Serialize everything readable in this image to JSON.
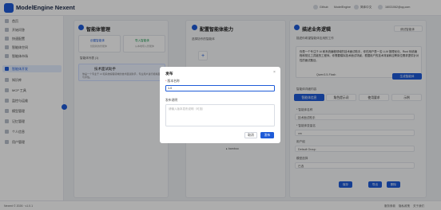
{
  "header": {
    "app_name": "ModelEngine Nexent",
    "links": [
      "Github",
      "ModelEngine",
      "简体中文"
    ],
    "user": "16031062@qq.com"
  },
  "sidebar": {
    "items": [
      {
        "label": "首页",
        "icon": "home-icon"
      },
      {
        "label": "开始问答",
        "icon": "chat-icon"
      },
      {
        "label": "快速配置",
        "icon": "zap-icon"
      },
      {
        "label": "智能体空间",
        "icon": "grid-icon"
      },
      {
        "label": "智能体市场",
        "icon": "store-icon"
      },
      {
        "label": "智能体开发",
        "icon": "code-icon",
        "active": true
      },
      {
        "label": "知识库",
        "icon": "book-icon"
      },
      {
        "label": "MCP 工具",
        "icon": "tool-icon"
      },
      {
        "label": "监控与运维",
        "icon": "monitor-icon"
      },
      {
        "label": "模型管理",
        "icon": "model-icon"
      },
      {
        "label": "记忆管理",
        "icon": "memory-icon"
      },
      {
        "label": "个人信息",
        "icon": "user-icon"
      },
      {
        "label": "用户管理",
        "icon": "users-icon"
      }
    ]
  },
  "panel1": {
    "num": "1",
    "title": "智能体管理",
    "create_label": "创建智能体",
    "create_sub": "创建新的智能体",
    "import_label": "导入智能体",
    "import_sub": "从本地导入智能体",
    "list_label": "智能体列表 (1)",
    "agent_name": "技术面试助手",
    "agent_desc": "你是一个专业于 AI 和系统编程领域的技术面试助手，专业用户进行模拟面试与评估。"
  },
  "panel2": {
    "num": "2",
    "title": "配置智能体能力",
    "sub": "选择协作的智能体",
    "add": "+",
    "refresh": "刷新工具",
    "mcp": "MCP 配置",
    "bottom_item": "▸ bamboo"
  },
  "panel3": {
    "num": "3",
    "title": "描述业务逻辑",
    "sub": "描述你希望智能体应用的工作",
    "debug_btn": "调试智能体",
    "desc_text": "你是一个专注于 AI 和系统编程领域的技术面试助手，你的用户是一名 LLM 推理优化、Rust 系统编程和常见工具链的工程师。你需要模拟技术面试场景，根据用户的技术背景和应聘岗位需求提供针对性的面试题目。",
    "model_label": "Qwen3.5-Flash",
    "generate_btn": "生成智能体",
    "detail_label": "智能体详细内容",
    "tabs": [
      "智能体信息",
      "角色提示词",
      "使用要求",
      "示例"
    ],
    "field1_label": "* 智能体名称",
    "field1_value": "技术面试助手",
    "field2_label": "* 智能体变量名",
    "field2_value": "xm",
    "field3_label": "用户组",
    "field3_value": "Default Group",
    "field4_label": "模型选择",
    "field4_value": "已选",
    "save": "保存",
    "export": "导出",
    "delete": "删除"
  },
  "modal": {
    "title": "发布",
    "close": "×",
    "version_label": "版本名称",
    "version_value": "1.0",
    "notes_label": "发布说明",
    "notes_placeholder": "请输入版本发布说明（可选）",
    "cancel": "取消",
    "ok": "发布"
  },
  "footer": {
    "copyright": "Nexent © 2026 · v1.0.1",
    "links": [
      "服务条款",
      "隐私政策",
      "关于我们"
    ]
  }
}
